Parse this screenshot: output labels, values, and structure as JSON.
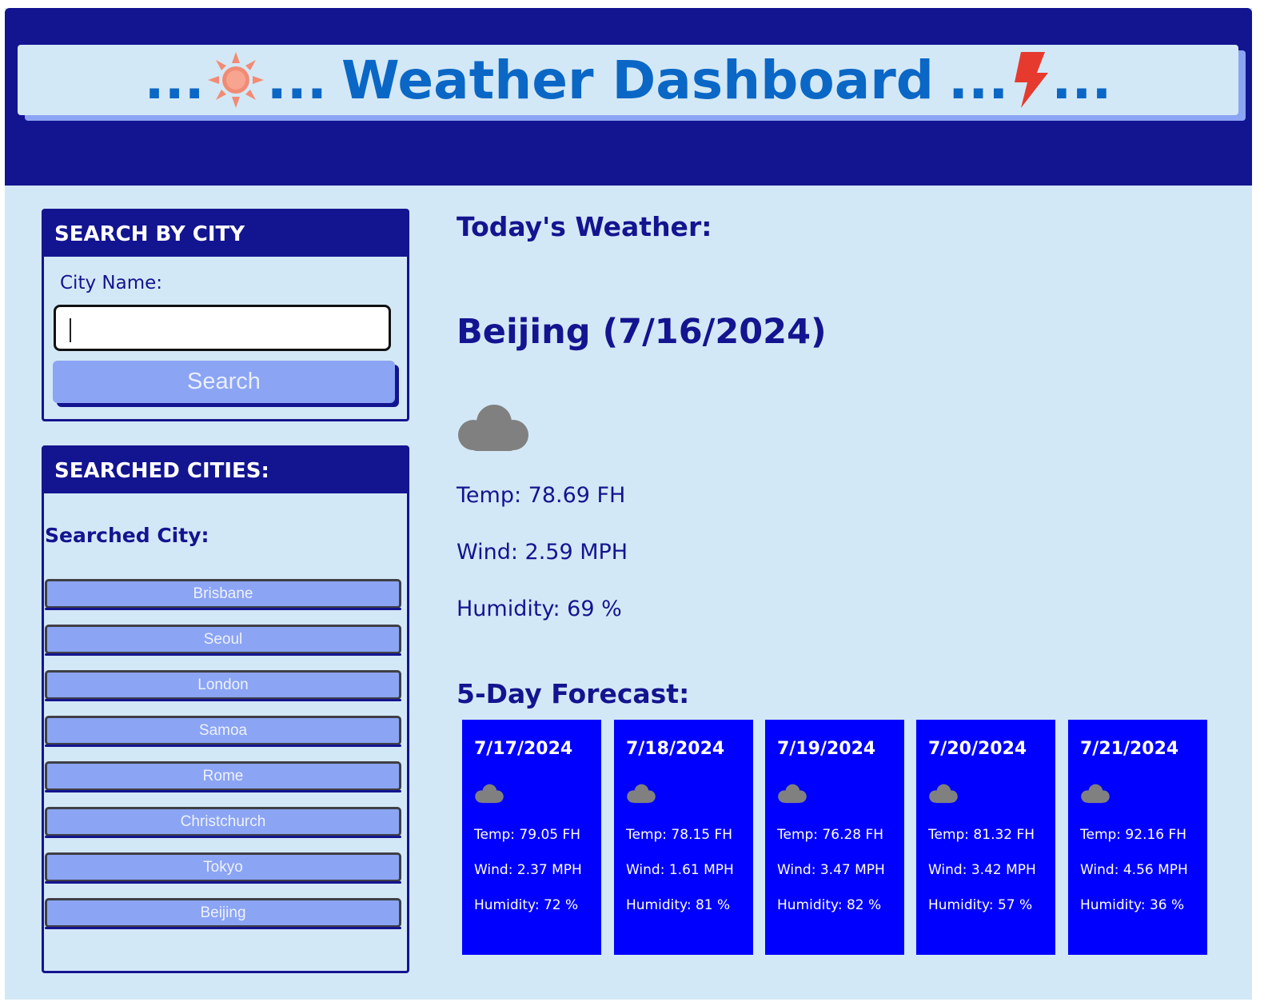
{
  "header": {
    "title_prefix": "...",
    "title_mid_1": "...",
    "title_text": "Weather Dashboard",
    "title_mid_2": "...",
    "title_suffix": "...",
    "left_icon": "sun-icon",
    "right_icon": "lightning-bolt-icon"
  },
  "search": {
    "heading": "SEARCH BY CITY",
    "label": "City Name:",
    "input_value": "",
    "button_label": "Search"
  },
  "history": {
    "heading": "SEARCHED CITIES:",
    "subheading": "Searched City:",
    "cities": [
      "Brisbane",
      "Seoul",
      "London",
      "Samoa",
      "Rome",
      "Christchurch",
      "Tokyo",
      "Beijing"
    ]
  },
  "today": {
    "heading": "Today's Weather:",
    "city_date": "Beijing (7/16/2024)",
    "icon": "cloud-icon",
    "temp": "Temp: 78.69 FH",
    "wind": "Wind: 2.59 MPH",
    "humidity": "Humidity: 69 %"
  },
  "forecast": {
    "heading": "5-Day Forecast:",
    "days": [
      {
        "date": "7/17/2024",
        "icon": "cloud-icon",
        "temp": "Temp: 79.05 FH",
        "wind": "Wind: 2.37 MPH",
        "humidity": "Humidity: 72 %"
      },
      {
        "date": "7/18/2024",
        "icon": "cloud-icon",
        "temp": "Temp: 78.15 FH",
        "wind": "Wind: 1.61 MPH",
        "humidity": "Humidity: 81 %"
      },
      {
        "date": "7/19/2024",
        "icon": "cloud-icon",
        "temp": "Temp: 76.28 FH",
        "wind": "Wind: 3.47 MPH",
        "humidity": "Humidity: 82 %"
      },
      {
        "date": "7/20/2024",
        "icon": "cloud-icon",
        "temp": "Temp: 81.32 FH",
        "wind": "Wind: 3.42 MPH",
        "humidity": "Humidity: 57 %"
      },
      {
        "date": "7/21/2024",
        "icon": "cloud-icon",
        "temp": "Temp: 92.16 FH",
        "wind": "Wind: 4.56 MPH",
        "humidity": "Humidity: 36 %"
      }
    ]
  },
  "colors": {
    "navy": "#131490",
    "background": "#d3e8f6",
    "title_blue": "#0a67c6",
    "button_periwinkle": "#8ba4f4",
    "card_blue": "#0000fe",
    "cloud_gray": "#808080"
  }
}
